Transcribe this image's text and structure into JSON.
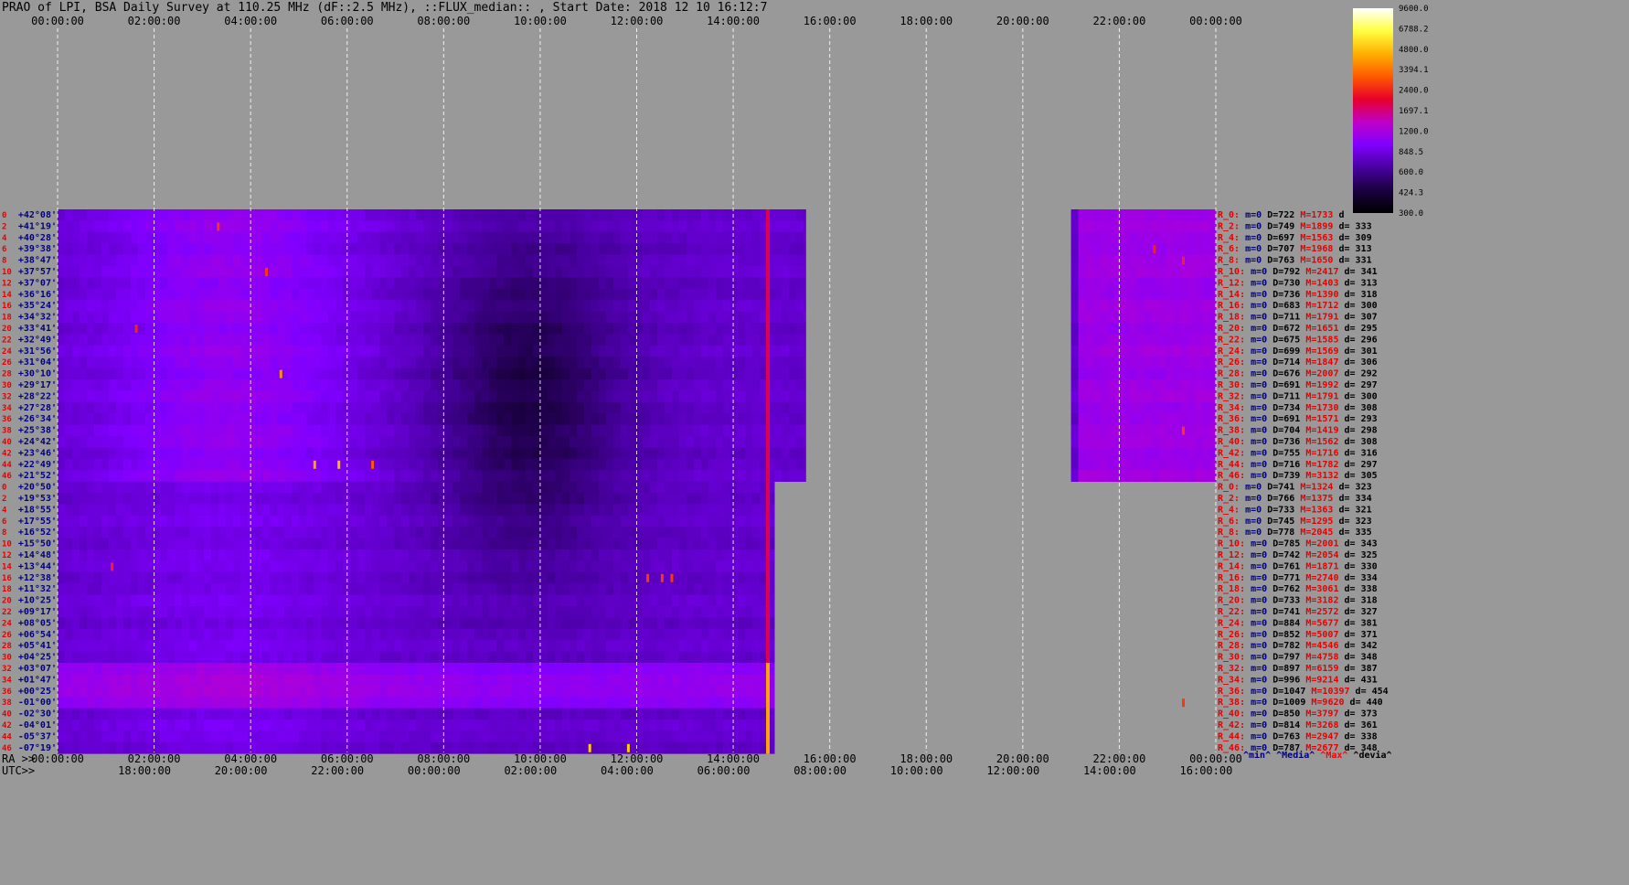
{
  "chart_data": {
    "type": "heatmap",
    "title": "PRAO of LPI, BSA Daily Survey at 110.25 MHz (dF::2.5 MHz), ::FLUX_median:: , Start Date: 2018 12 10 16:12:7",
    "top_axis_ticks": [
      "00:00:00",
      "02:00:00",
      "04:00:00",
      "06:00:00",
      "08:00:00",
      "10:00:00",
      "12:00:00",
      "14:00:00",
      "16:00:00",
      "18:00:00",
      "20:00:00",
      "22:00:00",
      "00:00:00"
    ],
    "ra_axis_label": "RA >>",
    "ra_axis_ticks": [
      "00:00:00",
      "02:00:00",
      "04:00:00",
      "06:00:00",
      "08:00:00",
      "10:00:00",
      "12:00:00",
      "14:00:00",
      "16:00:00",
      "18:00:00",
      "20:00:00",
      "22:00:00",
      "00:00:00"
    ],
    "utc_axis_label": "UTC>>",
    "utc_axis_ticks": [
      "18:00:00",
      "20:00:00",
      "22:00:00",
      "00:00:00",
      "02:00:00",
      "04:00:00",
      "06:00:00",
      "08:00:00",
      "10:00:00",
      "12:00:00",
      "14:00:00",
      "16:00:00"
    ],
    "colorbar_ticks": [
      "9600.0",
      "6788.2",
      "4800.0",
      "3394.1",
      "2400.0",
      "1697.1",
      "1200.0",
      "848.5",
      "600.0",
      "424.3",
      "300.0"
    ],
    "colorbar_range": [
      300,
      9600
    ],
    "colorbar_scale": "log",
    "colorbar_palette": [
      "#000000",
      "#1a0040",
      "#4800a0",
      "#8000ff",
      "#c000c8",
      "#e8002a",
      "#ff5a00",
      "#ffb000",
      "#ffff40",
      "#ffffff"
    ],
    "data_ra_range_hours": [
      [
        0,
        15.5
      ],
      [
        21.0,
        24.0
      ]
    ],
    "beam_numbers": [
      0,
      2,
      4,
      6,
      8,
      10,
      12,
      14,
      16,
      18,
      20,
      22,
      24,
      26,
      28,
      30,
      32,
      34,
      36,
      38,
      40,
      42,
      44,
      46,
      0,
      2,
      4,
      6,
      8,
      10,
      12,
      14,
      16,
      18,
      20,
      22,
      24,
      26,
      28,
      30,
      32,
      34,
      36,
      38,
      40,
      42,
      44,
      46
    ],
    "declinations": [
      "+42°08'",
      "+41°19'",
      "+40°28'",
      "+39°38'",
      "+38°47'",
      "+37°57'",
      "+37°07'",
      "+36°16'",
      "+35°24'",
      "+34°32'",
      "+33°41'",
      "+32°49'",
      "+31°56'",
      "+31°04'",
      "+30°10'",
      "+29°17'",
      "+28°22'",
      "+27°28'",
      "+26°34'",
      "+25°38'",
      "+24°42'",
      "+23°46'",
      "+22°49'",
      "+21°52'",
      "+20°50'",
      "+19°53'",
      "+18°55'",
      "+17°55'",
      "+16°52'",
      "+15°50'",
      "+14°48'",
      "+13°44'",
      "+12°38'",
      "+11°32'",
      "+10°25'",
      "+09°17'",
      "+08°05'",
      "+06°54'",
      "+05°41'",
      "+04°25'",
      "+03°07'",
      "+01°47'",
      "+00°25'",
      "-01°00'",
      "-02°30'",
      "-04°01'",
      "-05°37'",
      "-07°19'"
    ],
    "stats_rows": [
      {
        "name": "R_0:",
        "m": "m=0",
        "D": "D=722",
        "M": "M=1733",
        "d": "d"
      },
      {
        "name": "R_2:",
        "m": "m=0",
        "D": "D=749",
        "M": "M=1899",
        "d": "d= 333"
      },
      {
        "name": "R_4:",
        "m": "m=0",
        "D": "D=697",
        "M": "M=1563",
        "d": "d= 309"
      },
      {
        "name": "R_6:",
        "m": "m=0",
        "D": "D=707",
        "M": "M=1968",
        "d": "d= 313"
      },
      {
        "name": "R_8:",
        "m": "m=0",
        "D": "D=763",
        "M": "M=1650",
        "d": "d= 331"
      },
      {
        "name": "R_10:",
        "m": "m=0",
        "D": "D=792",
        "M": "M=2417",
        "d": "d= 341"
      },
      {
        "name": "R_12:",
        "m": "m=0",
        "D": "D=730",
        "M": "M=1403",
        "d": "d= 313"
      },
      {
        "name": "R_14:",
        "m": "m=0",
        "D": "D=736",
        "M": "M=1390",
        "d": "d= 318"
      },
      {
        "name": "R_16:",
        "m": "m=0",
        "D": "D=683",
        "M": "M=1712",
        "d": "d= 300"
      },
      {
        "name": "R_18:",
        "m": "m=0",
        "D": "D=711",
        "M": "M=1791",
        "d": "d= 307"
      },
      {
        "name": "R_20:",
        "m": "m=0",
        "D": "D=672",
        "M": "M=1651",
        "d": "d= 295"
      },
      {
        "name": "R_22:",
        "m": "m=0",
        "D": "D=675",
        "M": "M=1585",
        "d": "d= 296"
      },
      {
        "name": "R_24:",
        "m": "m=0",
        "D": "D=699",
        "M": "M=1569",
        "d": "d= 301"
      },
      {
        "name": "R_26:",
        "m": "m=0",
        "D": "D=714",
        "M": "M=1847",
        "d": "d= 306"
      },
      {
        "name": "R_28:",
        "m": "m=0",
        "D": "D=676",
        "M": "M=2007",
        "d": "d= 292"
      },
      {
        "name": "R_30:",
        "m": "m=0",
        "D": "D=691",
        "M": "M=1992",
        "d": "d= 297"
      },
      {
        "name": "R_32:",
        "m": "m=0",
        "D": "D=711",
        "M": "M=1791",
        "d": "d= 300"
      },
      {
        "name": "R_34:",
        "m": "m=0",
        "D": "D=734",
        "M": "M=1730",
        "d": "d= 308"
      },
      {
        "name": "R_36:",
        "m": "m=0",
        "D": "D=691",
        "M": "M=1571",
        "d": "d= 293"
      },
      {
        "name": "R_38:",
        "m": "m=0",
        "D": "D=704",
        "M": "M=1419",
        "d": "d= 298"
      },
      {
        "name": "R_40:",
        "m": "m=0",
        "D": "D=736",
        "M": "M=1562",
        "d": "d= 308"
      },
      {
        "name": "R_42:",
        "m": "m=0",
        "D": "D=755",
        "M": "M=1716",
        "d": "d= 316"
      },
      {
        "name": "R_44:",
        "m": "m=0",
        "D": "D=716",
        "M": "M=1782",
        "d": "d= 297"
      },
      {
        "name": "R_46:",
        "m": "m=0",
        "D": "D=739",
        "M": "M=3132",
        "d": "d= 305"
      },
      {
        "name": "R_0:",
        "m": "m=0",
        "D": "D=741",
        "M": "M=1324",
        "d": "d= 323"
      },
      {
        "name": "R_2:",
        "m": "m=0",
        "D": "D=766",
        "M": "M=1375",
        "d": "d= 334"
      },
      {
        "name": "R_4:",
        "m": "m=0",
        "D": "D=733",
        "M": "M=1363",
        "d": "d= 321"
      },
      {
        "name": "R_6:",
        "m": "m=0",
        "D": "D=745",
        "M": "M=1295",
        "d": "d= 323"
      },
      {
        "name": "R_8:",
        "m": "m=0",
        "D": "D=778",
        "M": "M=2045",
        "d": "d= 335"
      },
      {
        "name": "R_10:",
        "m": "m=0",
        "D": "D=785",
        "M": "M=2001",
        "d": "d= 343"
      },
      {
        "name": "R_12:",
        "m": "m=0",
        "D": "D=742",
        "M": "M=2054",
        "d": "d= 325"
      },
      {
        "name": "R_14:",
        "m": "m=0",
        "D": "D=761",
        "M": "M=1871",
        "d": "d= 330"
      },
      {
        "name": "R_16:",
        "m": "m=0",
        "D": "D=771",
        "M": "M=2740",
        "d": "d= 334"
      },
      {
        "name": "R_18:",
        "m": "m=0",
        "D": "D=762",
        "M": "M=3061",
        "d": "d= 338"
      },
      {
        "name": "R_20:",
        "m": "m=0",
        "D": "D=733",
        "M": "M=3182",
        "d": "d= 318"
      },
      {
        "name": "R_22:",
        "m": "m=0",
        "D": "D=741",
        "M": "M=2572",
        "d": "d= 327"
      },
      {
        "name": "R_24:",
        "m": "m=0",
        "D": "D=884",
        "M": "M=5677",
        "d": "d= 381"
      },
      {
        "name": "R_26:",
        "m": "m=0",
        "D": "D=852",
        "M": "M=5007",
        "d": "d= 371"
      },
      {
        "name": "R_28:",
        "m": "m=0",
        "D": "D=782",
        "M": "M=4546",
        "d": "d= 342"
      },
      {
        "name": "R_30:",
        "m": "m=0",
        "D": "D=797",
        "M": "M=4758",
        "d": "d= 348"
      },
      {
        "name": "R_32:",
        "m": "m=0",
        "D": "D=897",
        "M": "M=6159",
        "d": "d= 387"
      },
      {
        "name": "R_34:",
        "m": "m=0",
        "D": "D=996",
        "M": "M=9214",
        "d": "d= 431"
      },
      {
        "name": "R_36:",
        "m": "m=0",
        "D": "D=1047",
        "M": "M=10397",
        "d": "d= 454"
      },
      {
        "name": "R_38:",
        "m": "m=0",
        "D": "D=1009",
        "M": "M=9620",
        "d": "d= 440"
      },
      {
        "name": "R_40:",
        "m": "m=0",
        "D": "D=850",
        "M": "M=3797",
        "d": "d= 373"
      },
      {
        "name": "R_42:",
        "m": "m=0",
        "D": "D=814",
        "M": "M=3268",
        "d": "d= 361"
      },
      {
        "name": "R_44:",
        "m": "m=0",
        "D": "D=763",
        "M": "M=2947",
        "d": "d= 338"
      },
      {
        "name": "R_46:",
        "m": "m=0",
        "D": "D=787",
        "M": "M=2677",
        "d": "d= 348"
      }
    ],
    "stats_footer": [
      {
        "text": "^min^",
        "color": "#000080"
      },
      {
        "text": "^Media^",
        "color": "#000080"
      },
      {
        "text": "^Max^",
        "color": "#ff0000"
      },
      {
        "text": "^devia^",
        "color": "#000000"
      }
    ]
  },
  "colors": {
    "background": "#999999",
    "beam_label": "#e80000",
    "dec_label": "#000080",
    "stats_name": "#e80000",
    "stats_min": "#000080",
    "stats_D": "#000000",
    "stats_M": "#e80000",
    "stats_d": "#000000"
  }
}
